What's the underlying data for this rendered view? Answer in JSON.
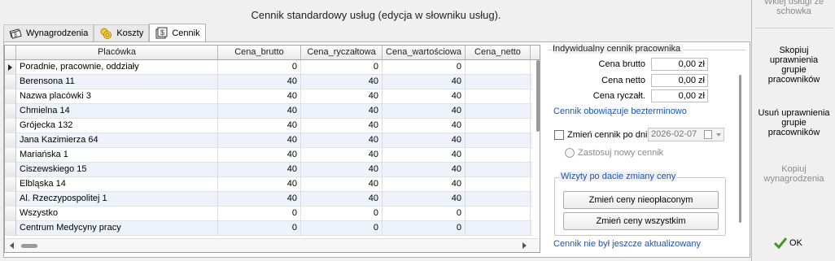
{
  "title": "Cennik standardowy usług (edycja w słowniku usług).",
  "tabs": [
    {
      "label": "Wynagrodzenia",
      "icon": "salary-icon"
    },
    {
      "label": "Koszty",
      "icon": "coins-icon"
    },
    {
      "label": "Cennik",
      "icon": "price-list-icon",
      "active": true
    }
  ],
  "grid": {
    "columns": [
      "Placówka",
      "Cena_brutto",
      "Cena_ryczałtowa",
      "Cena_wartościowa",
      "Cena_netto"
    ],
    "rows": [
      [
        "Poradnie, pracownie, oddziały",
        "0",
        "0",
        "0",
        ""
      ],
      [
        "Berensona 11",
        "40",
        "40",
        "40",
        ""
      ],
      [
        "Nazwa placówki 3",
        "40",
        "40",
        "40",
        ""
      ],
      [
        "Chmielna 14",
        "40",
        "40",
        "40",
        ""
      ],
      [
        "Grójecka 132",
        "40",
        "40",
        "40",
        ""
      ],
      [
        "Jana Kazimierza 64",
        "40",
        "40",
        "40",
        ""
      ],
      [
        "Mariańska 1",
        "40",
        "40",
        "40",
        ""
      ],
      [
        "Ciszewskiego 15",
        "40",
        "40",
        "40",
        ""
      ],
      [
        "Elbląska 14",
        "40",
        "40",
        "40",
        ""
      ],
      [
        "Al. Rzeczypospolitej 1",
        "40",
        "40",
        "40",
        ""
      ],
      [
        "Wszystko",
        "0",
        "0",
        "0",
        ""
      ],
      [
        "Centrum Medycyny pracy",
        "0",
        "0",
        "0",
        ""
      ]
    ]
  },
  "panel": {
    "title": "Indywidualny cennik pracownika",
    "brutto_label": "Cena brutto",
    "brutto_value": "0,00 zł",
    "netto_label": "Cena netto",
    "netto_value": "0,00 zł",
    "ryczalt_label": "Cena ryczałt.",
    "ryczalt_value": "0,00 zł",
    "validity_text": "Cennik obowiązuje bezterminowo",
    "change_checkbox_label": "Zmień cennik po dniu",
    "change_date": "2026-02-07",
    "apply_radio_label": "Zastosuj nowy cennik",
    "group_title": "Wizyty po dacie zmiany ceny",
    "btn_unpaid": "Zmień ceny nieopłaconym",
    "btn_all": "Zmień ceny wszystkim",
    "update_status": "Cennik nie był jeszcze aktualizowany"
  },
  "side": {
    "paste_line1": "Wklej usługi ze",
    "paste_line2": "schowka",
    "copy_line1": "Skopiuj",
    "copy_line2": "uprawnienia",
    "copy_line3": "grupie",
    "copy_line4": "pracowników",
    "remove_line1": "Usuń uprawnienia",
    "remove_line2": "grupie",
    "remove_line3": "pracowników",
    "copysal_line1": "Kopiuj",
    "copysal_line2": "wynagrodzenia",
    "ok_label": "OK"
  }
}
